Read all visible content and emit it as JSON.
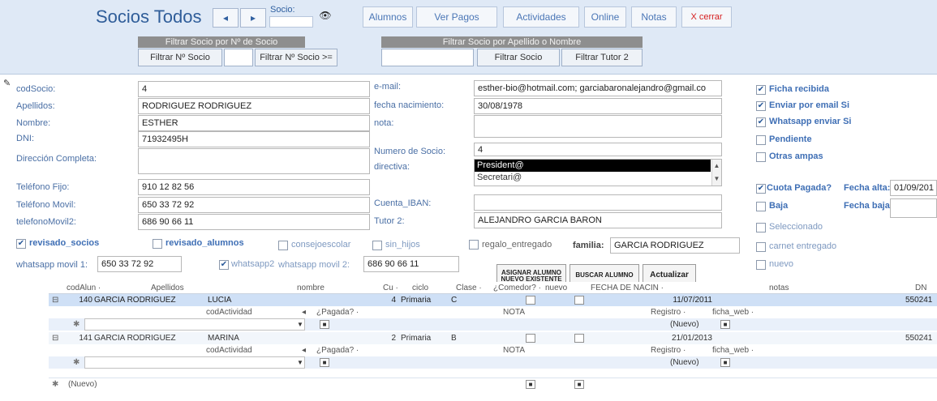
{
  "header": {
    "title": "Socios Todos",
    "nav_prev": "◂",
    "nav_next": "▸",
    "socio_label": "Socio:",
    "binoculars_glyph": "👁",
    "buttons": {
      "alumnos": "Alumnos",
      "ver_pagos": "Ver Pagos",
      "actividades": "Actividades",
      "online": "Online",
      "notas": "Notas",
      "cerrar": "X cerrar"
    },
    "filter_num_band": "Filtrar Socio por Nº de Socio",
    "filter_num_eq": "Filtrar Nº Socio",
    "filter_num_ge": "Filtrar Nº Socio >=",
    "filter_name_band": "Filtrar Socio por Apellido o Nombre",
    "filter_socio": "Filtrar Socio",
    "filter_tutor": "Filtrar Tutor 2"
  },
  "form": {
    "labels": {
      "codsocio": "codSocio:",
      "apellidos": "Apellidos:",
      "nombre": "Nombre:",
      "dni": "DNI:",
      "direccion": "Dirección Completa:",
      "tel_fijo": "Teléfono Fijo:",
      "tel_movil": "Teléfono Movil:",
      "tel_movil2": "telefonoMovil2:",
      "email": "e-mail:",
      "fecha_nac": "fecha nacimiento:",
      "nota": "nota:",
      "num_socio": "Numero de Socio:",
      "directiva": "directiva:",
      "iban": "Cuenta_IBAN:",
      "tutor2": "Tutor 2:",
      "familia": "familia:",
      "whatsapp1": "whatsapp movil 1:",
      "whatsapp_movil2": "whatsapp movil 2:",
      "fecha_alta": "Fecha alta:",
      "fecha_baja": "Fecha baja:"
    },
    "values": {
      "codsocio": "4",
      "apellidos": "RODRIGUEZ RODRIGUEZ",
      "nombre": "ESTHER",
      "dni": "71932495H",
      "direccion": "",
      "tel_fijo": "910 12 82 56",
      "tel_movil": "650 33 72 92",
      "tel_movil2": "686 90 66 11",
      "email": "esther-bio@hotmail.com; garciabaronalejandro@gmail.co",
      "fecha_nac": "30/08/1978",
      "nota": "",
      "num_socio": "4",
      "iban": "",
      "tutor2": "ALEJANDRO GARCIA BARON",
      "familia": "GARCIA RODRIGUEZ",
      "whatsapp1": "650 33 72 92",
      "whatsapp_movil2": "686 90 66 11",
      "fecha_alta": "01/09/201",
      "fecha_baja": ""
    },
    "directiva_options": [
      "President@",
      "Secretari@"
    ],
    "checks_row": {
      "revisado_socios": "revisado_socios",
      "revisado_alumnos": "revisado_alumnos",
      "consejoescolar": "consejoescolar",
      "sin_hijos": "sin_hijos",
      "regalo": "regalo_entregado",
      "whatsapp2": "whatsapp2"
    },
    "checks_right": {
      "ficha": "Ficha recibida",
      "email_si": "Enviar por email Si",
      "whatsapp_si": "Whatsapp enviar Si",
      "pendiente": "Pendiente",
      "otras_ampas": "Otras ampas",
      "cuota": "Cuota Pagada?",
      "baja": "Baja",
      "seleccionado": "Seleccionado",
      "carnet": "carnet entregado",
      "nuevo": "nuevo"
    },
    "actions": {
      "asignar_1": "ASIGNAR ALUMNO",
      "asignar_2": "NUEVO EXISTENTE",
      "buscar": "BUSCAR ALUMNO",
      "actualizar": "Actualizar"
    },
    "check_mark": "✔"
  },
  "grid": {
    "headers": {
      "cod": "codAlun ·",
      "apellidos": "Apellidos",
      "nombre": "nombre",
      "cu": "Cu ·",
      "ciclo": "ciclo",
      "clase": "Clase ·",
      "comedor": "¿Comedor? ·",
      "nuevo": "nuevo",
      "fecha": "FECHA DE NACIN ·",
      "notas": "notas",
      "dni": "DN"
    },
    "sub_headers": {
      "cod_act": "codActividad",
      "pagada": "¿Pagada? ·",
      "nota": "NOTA",
      "registro": "Registro ·",
      "ficha": "ficha_web ·"
    },
    "rows": [
      {
        "cod": "140",
        "apellidos": "GARCIA RODRIGUEZ",
        "nombre": "LUCIA",
        "cu": "4",
        "ciclo": "Primaria",
        "clase": "C",
        "fecha": "11/07/2011",
        "dni": "550241"
      },
      {
        "cod": "141",
        "apellidos": "GARCIA RODRIGUEZ",
        "nombre": "MARINA",
        "cu": "2",
        "ciclo": "Primaria",
        "clase": "B",
        "fecha": "21/01/2013",
        "dni": "550241"
      }
    ],
    "sub_new": "(Nuevo)",
    "new_row": "(Nuevo)",
    "new_star": "✱",
    "expand_minus": "⊟"
  }
}
